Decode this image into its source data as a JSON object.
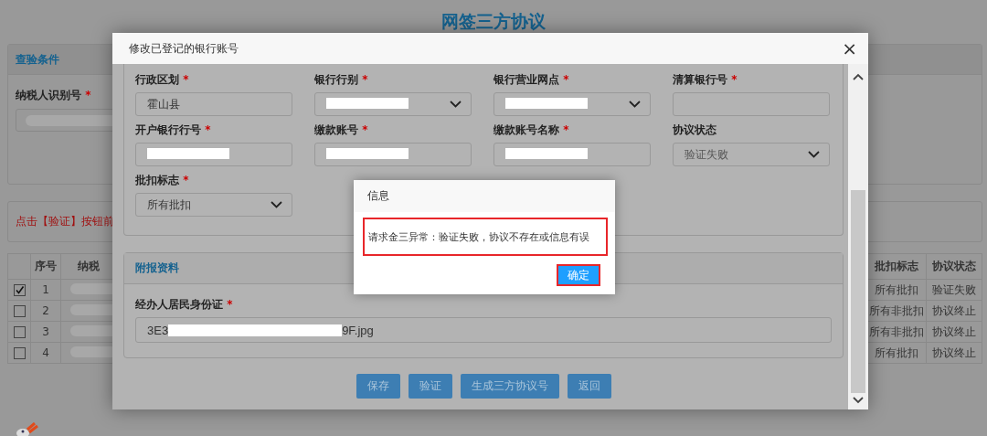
{
  "page": {
    "title": "网签三方协议",
    "query_card": {
      "title": "查验条件",
      "field_label": "纳税人识别号",
      "required_mark": "*",
      "redacted": true
    },
    "hint": "点击【验证】按钮前",
    "table": {
      "columns": [
        "序号",
        "纳税",
        "批扣标志",
        "协议状态"
      ],
      "rows": [
        {
          "checked": true,
          "seq": "1",
          "redacted": true,
          "flag": "所有批扣",
          "status": "验证失败"
        },
        {
          "checked": false,
          "seq": "2",
          "redacted": true,
          "flag": "所有非批扣",
          "status": "协议终止"
        },
        {
          "checked": false,
          "seq": "3",
          "redacted": true,
          "flag": "所有非批扣",
          "status": "协议终止"
        },
        {
          "checked": false,
          "seq": "4",
          "redacted": true,
          "flag": "所有批扣",
          "status": "协议终止"
        }
      ]
    }
  },
  "modal": {
    "title": "修改已登记的银行账号",
    "close": "×",
    "fields": [
      {
        "label": "行政区划",
        "required_mark": "*",
        "kind": "text",
        "value": "霍山县",
        "redacted": false
      },
      {
        "label": "银行行别",
        "required_mark": "*",
        "kind": "select",
        "redacted": true
      },
      {
        "label": "银行营业网点",
        "required_mark": "*",
        "kind": "select",
        "redacted": true
      },
      {
        "label": "清算银行号",
        "required_mark": "*",
        "kind": "text",
        "redacted": false
      },
      {
        "label": "开户银行行号",
        "required_mark": "*",
        "kind": "text",
        "redacted": true
      },
      {
        "label": "缴款账号",
        "required_mark": "*",
        "kind": "text",
        "redacted": true
      },
      {
        "label": "缴款账号名称",
        "required_mark": "*",
        "kind": "text",
        "redacted": true
      },
      {
        "label": "协议状态",
        "kind": "select",
        "value": "验证失败",
        "redacted": false
      },
      {
        "label": "批扣标志",
        "required_mark": "*",
        "kind": "select",
        "value": "所有批扣",
        "redacted": false
      }
    ],
    "attachments": {
      "title": "附报资料",
      "label": "经办人居民身份证",
      "required_mark": "*",
      "value_start": "3E3",
      "value_end": "9F.jpg"
    },
    "buttons": [
      "保存",
      "验证",
      "生成三方协议号",
      "返回"
    ]
  },
  "dialog": {
    "title": "信息",
    "message": "请求金三异常：验证失败，协议不存在或信息有误",
    "message_highlighted": true,
    "button": "确定",
    "button_highlighted": true
  }
}
